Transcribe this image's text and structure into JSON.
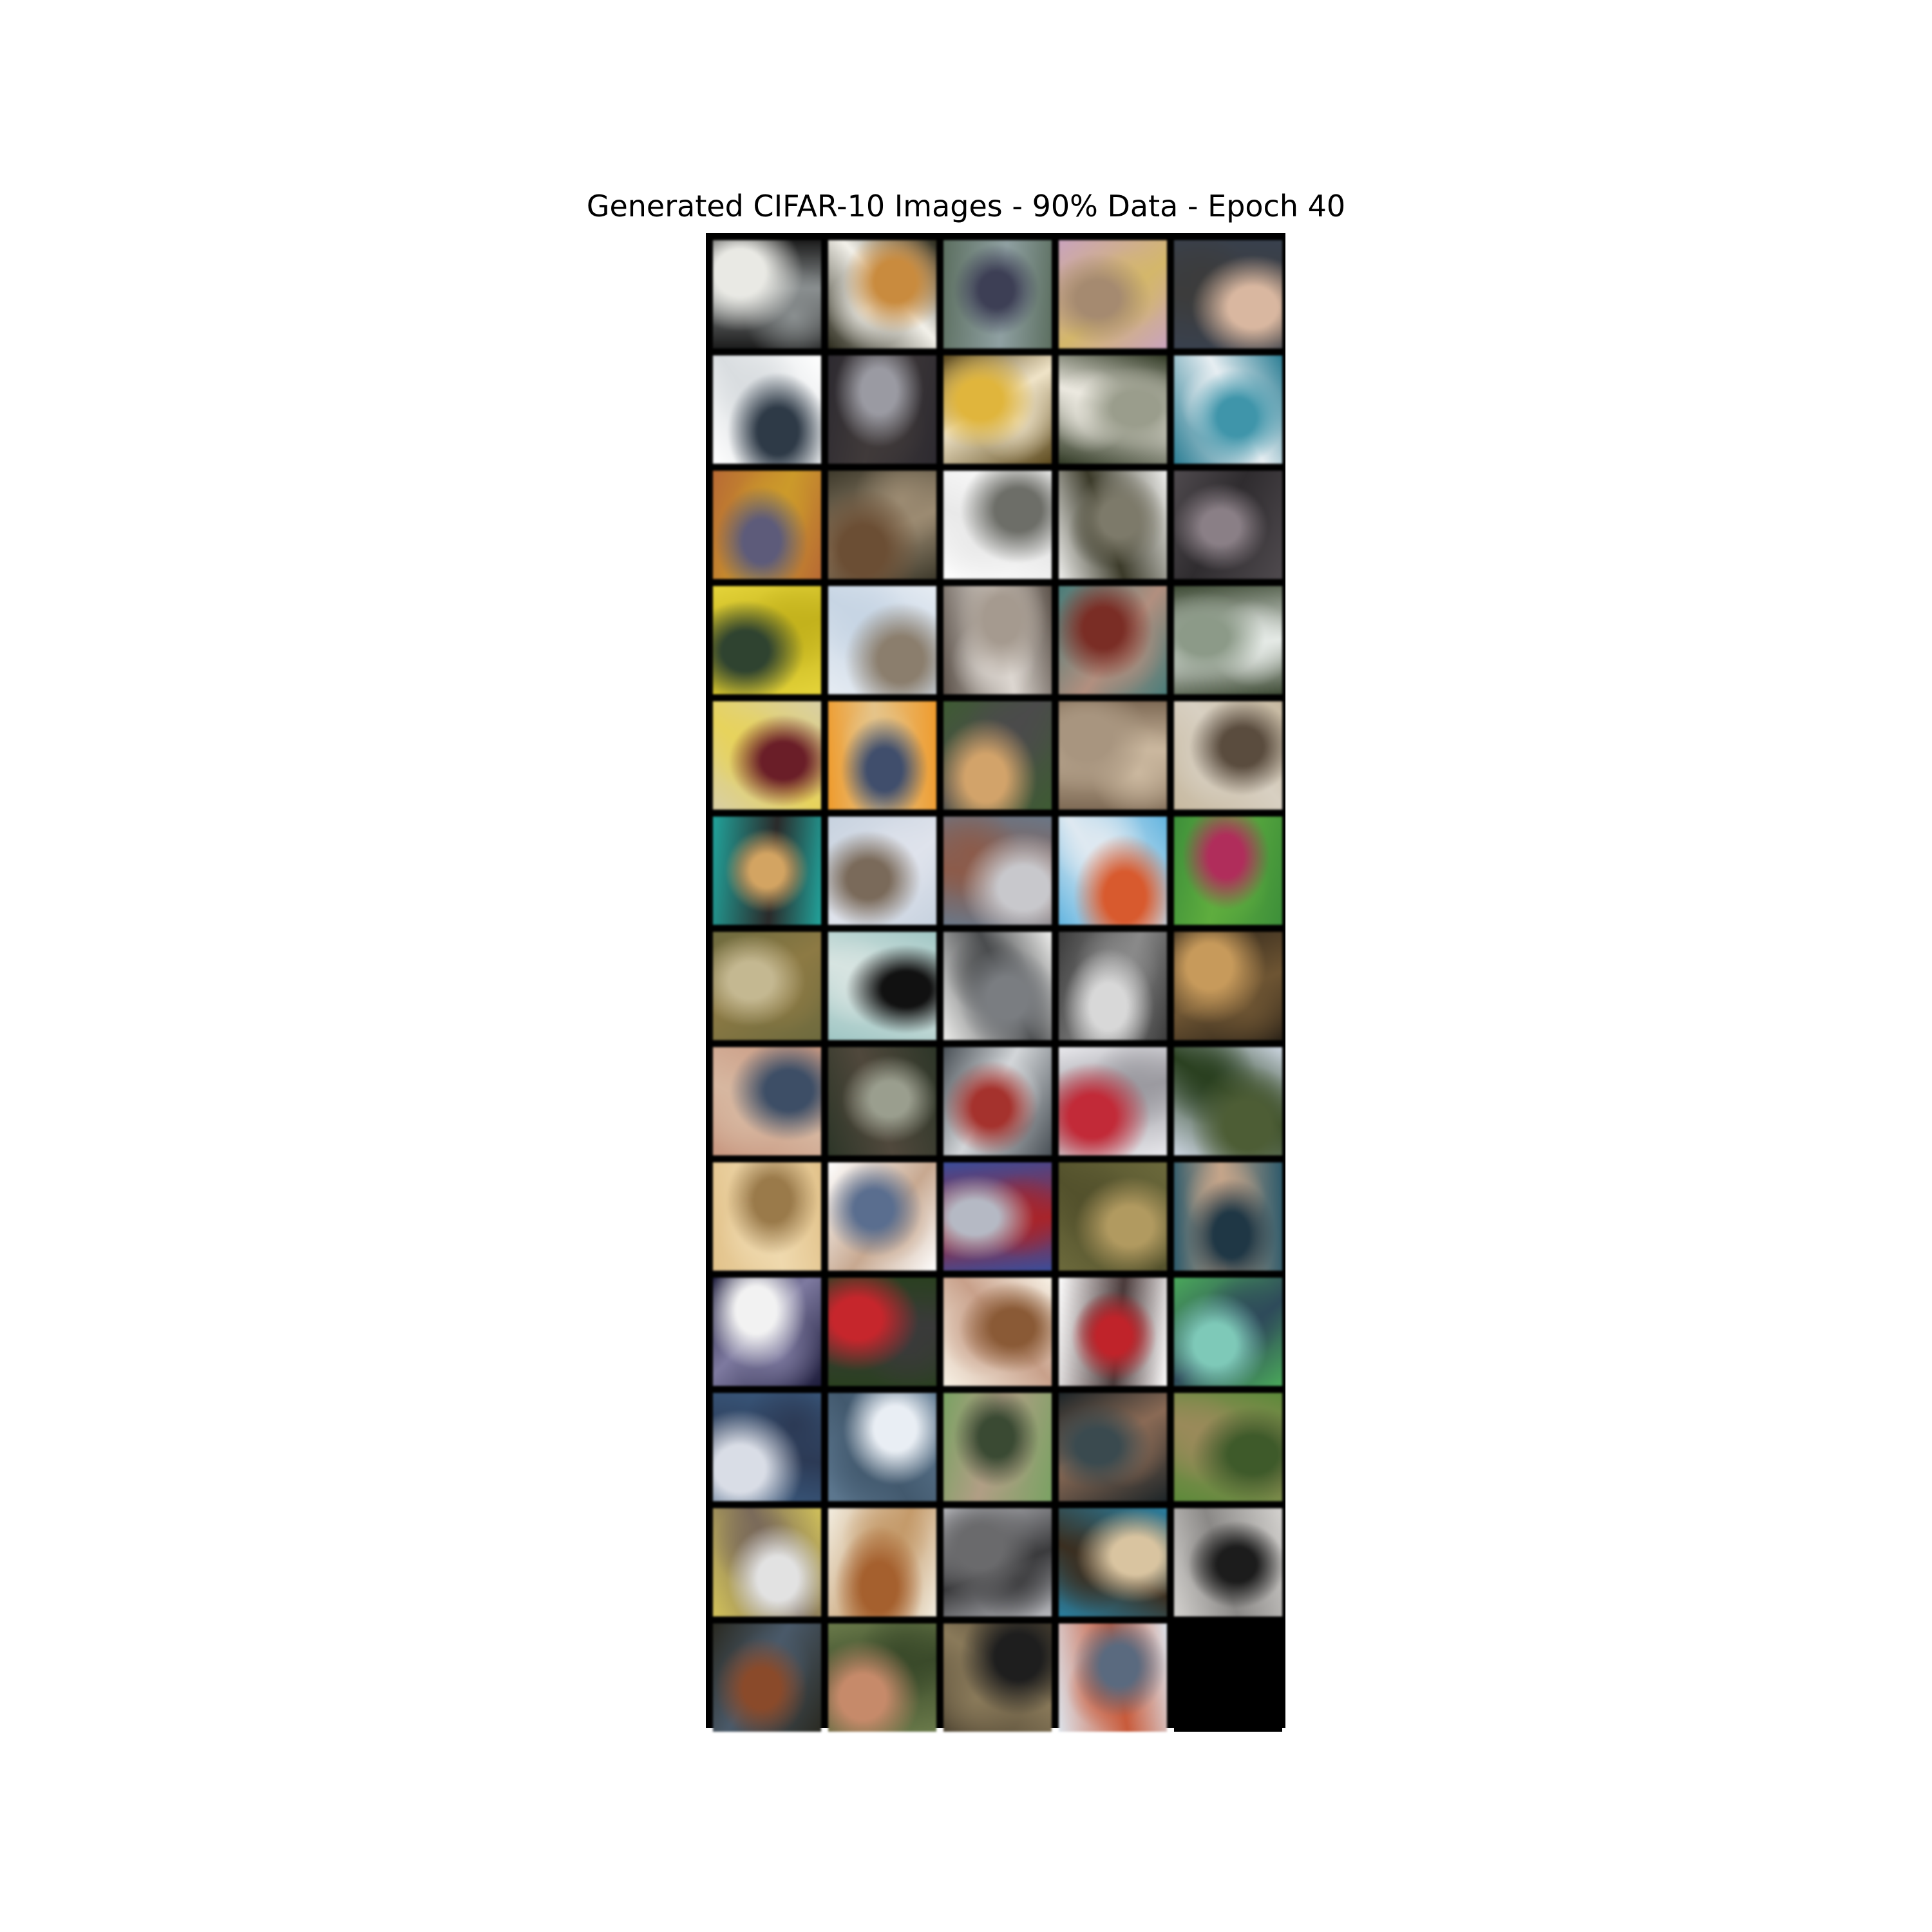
{
  "figure": {
    "title": "Generated CIFAR-10 Images - 90% Data - Epoch 40"
  },
  "grid": {
    "columns": 5,
    "rows": 13,
    "border_color": "#000000",
    "tiles": [
      {
        "c": [
          "#1c1c1c",
          "#e9e9e4",
          "#8a8f90"
        ]
      },
      {
        "c": [
          "#2b2a1c",
          "#c98b3e",
          "#f3f1ea"
        ]
      },
      {
        "c": [
          "#5c6f60",
          "#3d3f55",
          "#8fa0a2"
        ]
      },
      {
        "c": [
          "#c9a3be",
          "#a58a70",
          "#d4b76a"
        ]
      },
      {
        "c": [
          "#39414e",
          "#d9b7a0",
          "#3c3c3c"
        ]
      },
      {
        "c": [
          "#ffffff",
          "#2e3a47",
          "#d9dde0"
        ]
      },
      {
        "c": [
          "#2d2a30",
          "#9a9aa2",
          "#403a3a"
        ]
      },
      {
        "c": [
          "#5d4a1d",
          "#e0b53c",
          "#f0e4c8"
        ]
      },
      {
        "c": [
          "#313a25",
          "#9a9d8c",
          "#ece9e0"
        ]
      },
      {
        "c": [
          "#2c7e94",
          "#3f95aa",
          "#e7eef2"
        ]
      },
      {
        "c": [
          "#b86a34",
          "#5d5b7a",
          "#cc9a2a"
        ]
      },
      {
        "c": [
          "#3e3a2c",
          "#6b4e34",
          "#9c8b72"
        ]
      },
      {
        "c": [
          "#ffffff",
          "#6d6e68",
          "#e9e9e9"
        ]
      },
      {
        "c": [
          "#f0f0ee",
          "#7d7a6a",
          "#3b3a29"
        ]
      },
      {
        "c": [
          "#4f4a4e",
          "#8a7f86",
          "#2f2c2f"
        ]
      },
      {
        "c": [
          "#e5d43a",
          "#2f4330",
          "#c3b21c"
        ]
      },
      {
        "c": [
          "#e6ecf3",
          "#8b7e6d",
          "#c7d5e4"
        ]
      },
      {
        "c": [
          "#5a5048",
          "#a59a8f",
          "#ddd7d1"
        ]
      },
      {
        "c": [
          "#4a7d7a",
          "#7a2d25",
          "#b28f7f"
        ]
      },
      {
        "c": [
          "#3d4a34",
          "#8c9a88",
          "#e5eae6"
        ]
      },
      {
        "c": [
          "#d8cfa5",
          "#6a1e28",
          "#e7d35c"
        ]
      },
      {
        "c": [
          "#ef9b2c",
          "#404e6c",
          "#e5c48a"
        ]
      },
      {
        "c": [
          "#3e5b33",
          "#d2a36a",
          "#4b4b4b"
        ]
      },
      {
        "c": [
          "#7e6a55",
          "#a8957f",
          "#cbb89f"
        ]
      },
      {
        "c": [
          "#c7b9a0",
          "#5a4c3e",
          "#d8d0c2"
        ]
      },
      {
        "c": [
          "#21a39b",
          "#d3a462",
          "#2a2a2a"
        ]
      },
      {
        "c": [
          "#c7d2df",
          "#7a6a5a",
          "#dfe3ec"
        ]
      },
      {
        "c": [
          "#6a7787",
          "#c8c8cc",
          "#8c5b4a"
        ]
      },
      {
        "c": [
          "#63b5e0",
          "#d85a2e",
          "#dfe9f1"
        ]
      },
      {
        "c": [
          "#3d8f3a",
          "#b02d5b",
          "#5fad3e"
        ]
      },
      {
        "c": [
          "#6d6a3e",
          "#c4b891",
          "#8d7a44"
        ]
      },
      {
        "c": [
          "#9fc6c4",
          "#111111",
          "#d7e4e1"
        ]
      },
      {
        "c": [
          "#eeeeec",
          "#7a7d81",
          "#4a4c4e"
        ]
      },
      {
        "c": [
          "#3c3c3c",
          "#d8d8d8",
          "#8a8a8a"
        ]
      },
      {
        "c": [
          "#2d2419",
          "#c79a5b",
          "#6e5533"
        ]
      },
      {
        "c": [
          "#c89780",
          "#3d4e66",
          "#d7b7a0"
        ]
      },
      {
        "c": [
          "#2d3628",
          "#9a9e8e",
          "#50483c"
        ]
      },
      {
        "c": [
          "#495056",
          "#a5322d",
          "#d3d6d9"
        ]
      },
      {
        "c": [
          "#e8e8ec",
          "#c22a38",
          "#9b9aa0"
        ]
      },
      {
        "c": [
          "#cdd6e2",
          "#4d5d35",
          "#2a4020"
        ]
      },
      {
        "c": [
          "#e2c28a",
          "#9a7a4a",
          "#efd9ae"
        ]
      },
      {
        "c": [
          "#ffffff",
          "#5a6e8f",
          "#c7a890"
        ]
      },
      {
        "c": [
          "#3a4d9a",
          "#b5b9c4",
          "#a8242a"
        ]
      },
      {
        "c": [
          "#6c6a3c",
          "#b19a60",
          "#53512c"
        ]
      },
      {
        "c": [
          "#2d5a6b",
          "#1f3745",
          "#c5a58a"
        ]
      },
      {
        "c": [
          "#1c1b3a",
          "#f2f2f2",
          "#7e7aa0"
        ]
      },
      {
        "c": [
          "#2a4020",
          "#c6262c",
          "#3a3a3a"
        ]
      },
      {
        "c": [
          "#f8f2e6",
          "#8a5a36",
          "#c8a08a"
        ]
      },
      {
        "c": [
          "#ffffff",
          "#c0232a",
          "#4a3a3a"
        ]
      },
      {
        "c": [
          "#4aa85a",
          "#7ec9b8",
          "#2e4a5a"
        ]
      },
      {
        "c": [
          "#3a5a7f",
          "#d9dde6",
          "#2c3a55"
        ]
      },
      {
        "c": [
          "#5f7a92",
          "#e9eef4",
          "#42596e"
        ]
      },
      {
        "c": [
          "#7aa263",
          "#3a4a33",
          "#b19e85"
        ]
      },
      {
        "c": [
          "#1d2528",
          "#3a4a4f",
          "#8a6a55"
        ]
      },
      {
        "c": [
          "#5c8a3a",
          "#3e5a2a",
          "#9a8a5a"
        ]
      },
      {
        "c": [
          "#d2c25a",
          "#e2e2e2",
          "#7a6a5a"
        ]
      },
      {
        "c": [
          "#f2ede0",
          "#a5602e",
          "#c49a6a"
        ]
      },
      {
        "c": [
          "#babbc0",
          "#6a6a6c",
          "#3a3a3c"
        ]
      },
      {
        "c": [
          "#2a7fa0",
          "#d9c4a0",
          "#3a2e20"
        ]
      },
      {
        "c": [
          "#d4d2cf",
          "#1c1c1c",
          "#8a8886"
        ]
      },
      {
        "c": [
          "#2a2a22",
          "#8a4a2a",
          "#4a5a6a"
        ]
      },
      {
        "c": [
          "#6a7a4a",
          "#c68a6a",
          "#3a4a2a"
        ]
      },
      {
        "c": [
          "#4d4331",
          "#1e1e1e",
          "#8a7a5a"
        ]
      },
      {
        "c": [
          "#dde4ec",
          "#5a6a7f",
          "#c85a3a"
        ]
      },
      {
        "c": null
      }
    ]
  }
}
